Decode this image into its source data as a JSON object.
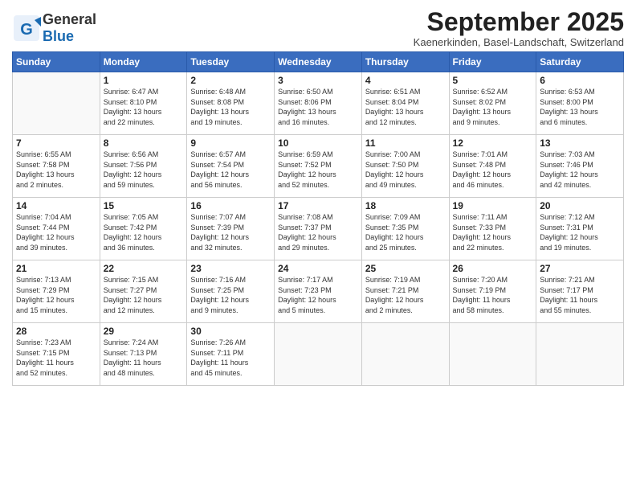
{
  "header": {
    "logo_general": "General",
    "logo_blue": "Blue",
    "month_title": "September 2025",
    "location": "Kaenerkinden, Basel-Landschaft, Switzerland"
  },
  "days_of_week": [
    "Sunday",
    "Monday",
    "Tuesday",
    "Wednesday",
    "Thursday",
    "Friday",
    "Saturday"
  ],
  "weeks": [
    [
      {
        "day": "",
        "info": ""
      },
      {
        "day": "1",
        "info": "Sunrise: 6:47 AM\nSunset: 8:10 PM\nDaylight: 13 hours\nand 22 minutes."
      },
      {
        "day": "2",
        "info": "Sunrise: 6:48 AM\nSunset: 8:08 PM\nDaylight: 13 hours\nand 19 minutes."
      },
      {
        "day": "3",
        "info": "Sunrise: 6:50 AM\nSunset: 8:06 PM\nDaylight: 13 hours\nand 16 minutes."
      },
      {
        "day": "4",
        "info": "Sunrise: 6:51 AM\nSunset: 8:04 PM\nDaylight: 13 hours\nand 12 minutes."
      },
      {
        "day": "5",
        "info": "Sunrise: 6:52 AM\nSunset: 8:02 PM\nDaylight: 13 hours\nand 9 minutes."
      },
      {
        "day": "6",
        "info": "Sunrise: 6:53 AM\nSunset: 8:00 PM\nDaylight: 13 hours\nand 6 minutes."
      }
    ],
    [
      {
        "day": "7",
        "info": "Sunrise: 6:55 AM\nSunset: 7:58 PM\nDaylight: 13 hours\nand 2 minutes."
      },
      {
        "day": "8",
        "info": "Sunrise: 6:56 AM\nSunset: 7:56 PM\nDaylight: 12 hours\nand 59 minutes."
      },
      {
        "day": "9",
        "info": "Sunrise: 6:57 AM\nSunset: 7:54 PM\nDaylight: 12 hours\nand 56 minutes."
      },
      {
        "day": "10",
        "info": "Sunrise: 6:59 AM\nSunset: 7:52 PM\nDaylight: 12 hours\nand 52 minutes."
      },
      {
        "day": "11",
        "info": "Sunrise: 7:00 AM\nSunset: 7:50 PM\nDaylight: 12 hours\nand 49 minutes."
      },
      {
        "day": "12",
        "info": "Sunrise: 7:01 AM\nSunset: 7:48 PM\nDaylight: 12 hours\nand 46 minutes."
      },
      {
        "day": "13",
        "info": "Sunrise: 7:03 AM\nSunset: 7:46 PM\nDaylight: 12 hours\nand 42 minutes."
      }
    ],
    [
      {
        "day": "14",
        "info": "Sunrise: 7:04 AM\nSunset: 7:44 PM\nDaylight: 12 hours\nand 39 minutes."
      },
      {
        "day": "15",
        "info": "Sunrise: 7:05 AM\nSunset: 7:42 PM\nDaylight: 12 hours\nand 36 minutes."
      },
      {
        "day": "16",
        "info": "Sunrise: 7:07 AM\nSunset: 7:39 PM\nDaylight: 12 hours\nand 32 minutes."
      },
      {
        "day": "17",
        "info": "Sunrise: 7:08 AM\nSunset: 7:37 PM\nDaylight: 12 hours\nand 29 minutes."
      },
      {
        "day": "18",
        "info": "Sunrise: 7:09 AM\nSunset: 7:35 PM\nDaylight: 12 hours\nand 25 minutes."
      },
      {
        "day": "19",
        "info": "Sunrise: 7:11 AM\nSunset: 7:33 PM\nDaylight: 12 hours\nand 22 minutes."
      },
      {
        "day": "20",
        "info": "Sunrise: 7:12 AM\nSunset: 7:31 PM\nDaylight: 12 hours\nand 19 minutes."
      }
    ],
    [
      {
        "day": "21",
        "info": "Sunrise: 7:13 AM\nSunset: 7:29 PM\nDaylight: 12 hours\nand 15 minutes."
      },
      {
        "day": "22",
        "info": "Sunrise: 7:15 AM\nSunset: 7:27 PM\nDaylight: 12 hours\nand 12 minutes."
      },
      {
        "day": "23",
        "info": "Sunrise: 7:16 AM\nSunset: 7:25 PM\nDaylight: 12 hours\nand 9 minutes."
      },
      {
        "day": "24",
        "info": "Sunrise: 7:17 AM\nSunset: 7:23 PM\nDaylight: 12 hours\nand 5 minutes."
      },
      {
        "day": "25",
        "info": "Sunrise: 7:19 AM\nSunset: 7:21 PM\nDaylight: 12 hours\nand 2 minutes."
      },
      {
        "day": "26",
        "info": "Sunrise: 7:20 AM\nSunset: 7:19 PM\nDaylight: 11 hours\nand 58 minutes."
      },
      {
        "day": "27",
        "info": "Sunrise: 7:21 AM\nSunset: 7:17 PM\nDaylight: 11 hours\nand 55 minutes."
      }
    ],
    [
      {
        "day": "28",
        "info": "Sunrise: 7:23 AM\nSunset: 7:15 PM\nDaylight: 11 hours\nand 52 minutes."
      },
      {
        "day": "29",
        "info": "Sunrise: 7:24 AM\nSunset: 7:13 PM\nDaylight: 11 hours\nand 48 minutes."
      },
      {
        "day": "30",
        "info": "Sunrise: 7:26 AM\nSunset: 7:11 PM\nDaylight: 11 hours\nand 45 minutes."
      },
      {
        "day": "",
        "info": ""
      },
      {
        "day": "",
        "info": ""
      },
      {
        "day": "",
        "info": ""
      },
      {
        "day": "",
        "info": ""
      }
    ]
  ]
}
